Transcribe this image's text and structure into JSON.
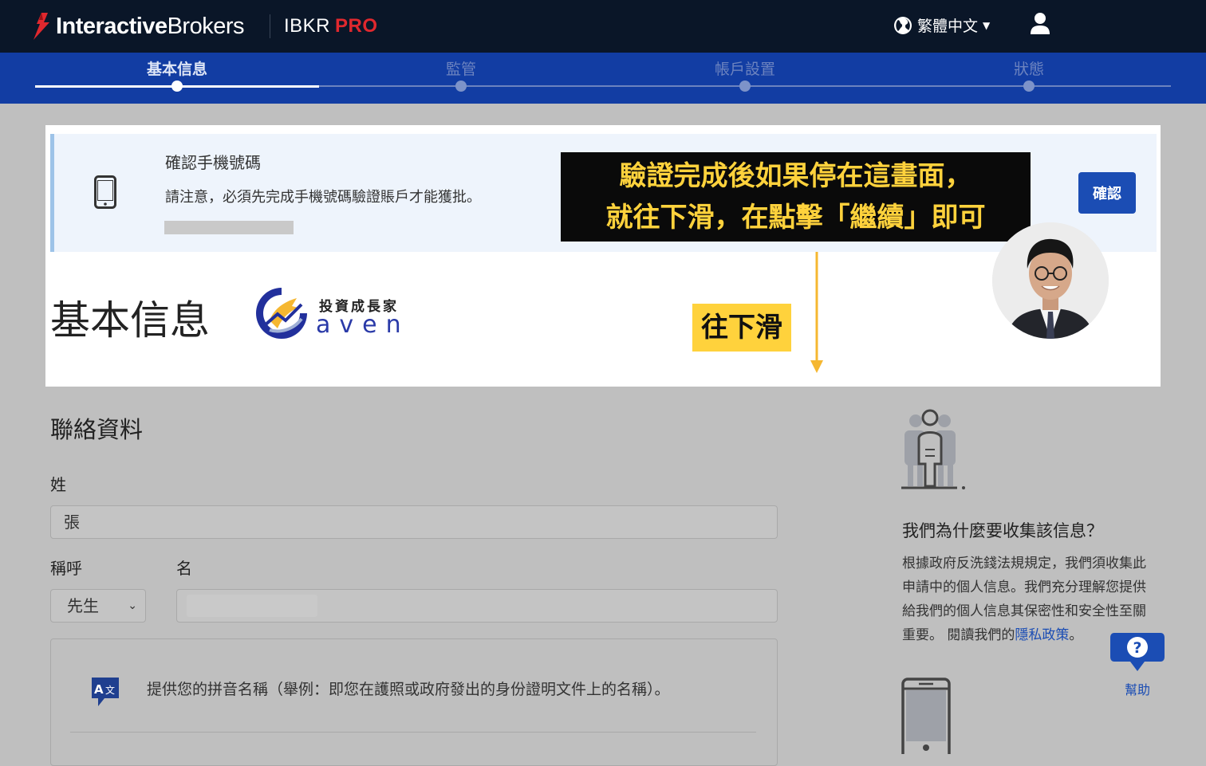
{
  "header": {
    "logo_bold": "Interactive",
    "logo_normal": "Brokers",
    "product": "IBKR",
    "product_tier": "PRO",
    "language": "繁體中文"
  },
  "steps": [
    {
      "label": "基本信息",
      "active": true
    },
    {
      "label": "監管",
      "active": false
    },
    {
      "label": "帳戶設置",
      "active": false
    },
    {
      "label": "狀態",
      "active": false
    }
  ],
  "notice": {
    "title": "確認手機號碼",
    "text": "請注意，必須先完成手機號碼驗證賬戶才能獲批。",
    "confirm_label": "確認"
  },
  "callout": {
    "line1": "驗證完成後如果停在這畫面，",
    "line2": "就往下滑，在點擊「繼續」即可"
  },
  "scroll_tag": "往下滑",
  "page_heading": "基本信息",
  "brand": {
    "tagline": "投資成長家",
    "name": "aven"
  },
  "contact": {
    "heading": "聯絡資料",
    "surname_label": "姓",
    "surname_value": "張",
    "salutation_label": "稱呼",
    "salutation_value": "先生",
    "given_label": "名",
    "pinyin_text": "提供您的拼音名稱（舉例：即您在護照或政府發出的身份證明文件上的名稱）。"
  },
  "side": {
    "why_heading": "我們為什麼要收集該信息？",
    "why_text": "根據政府反洗錢法規規定，我們須收集此申請中的個人信息。我們充分理解您提供給我們的個人信息其保密性和安全性至關重要。 閱讀我們的",
    "privacy_link": "隱私政策",
    "why_end": "。"
  },
  "help_label": "幫助",
  "colors": {
    "topbar": "#0a1628",
    "steps_bar": "#123da3",
    "brand_red": "#e0282e",
    "accent_blue": "#1b4db4",
    "callout_text": "#ffd23c"
  }
}
